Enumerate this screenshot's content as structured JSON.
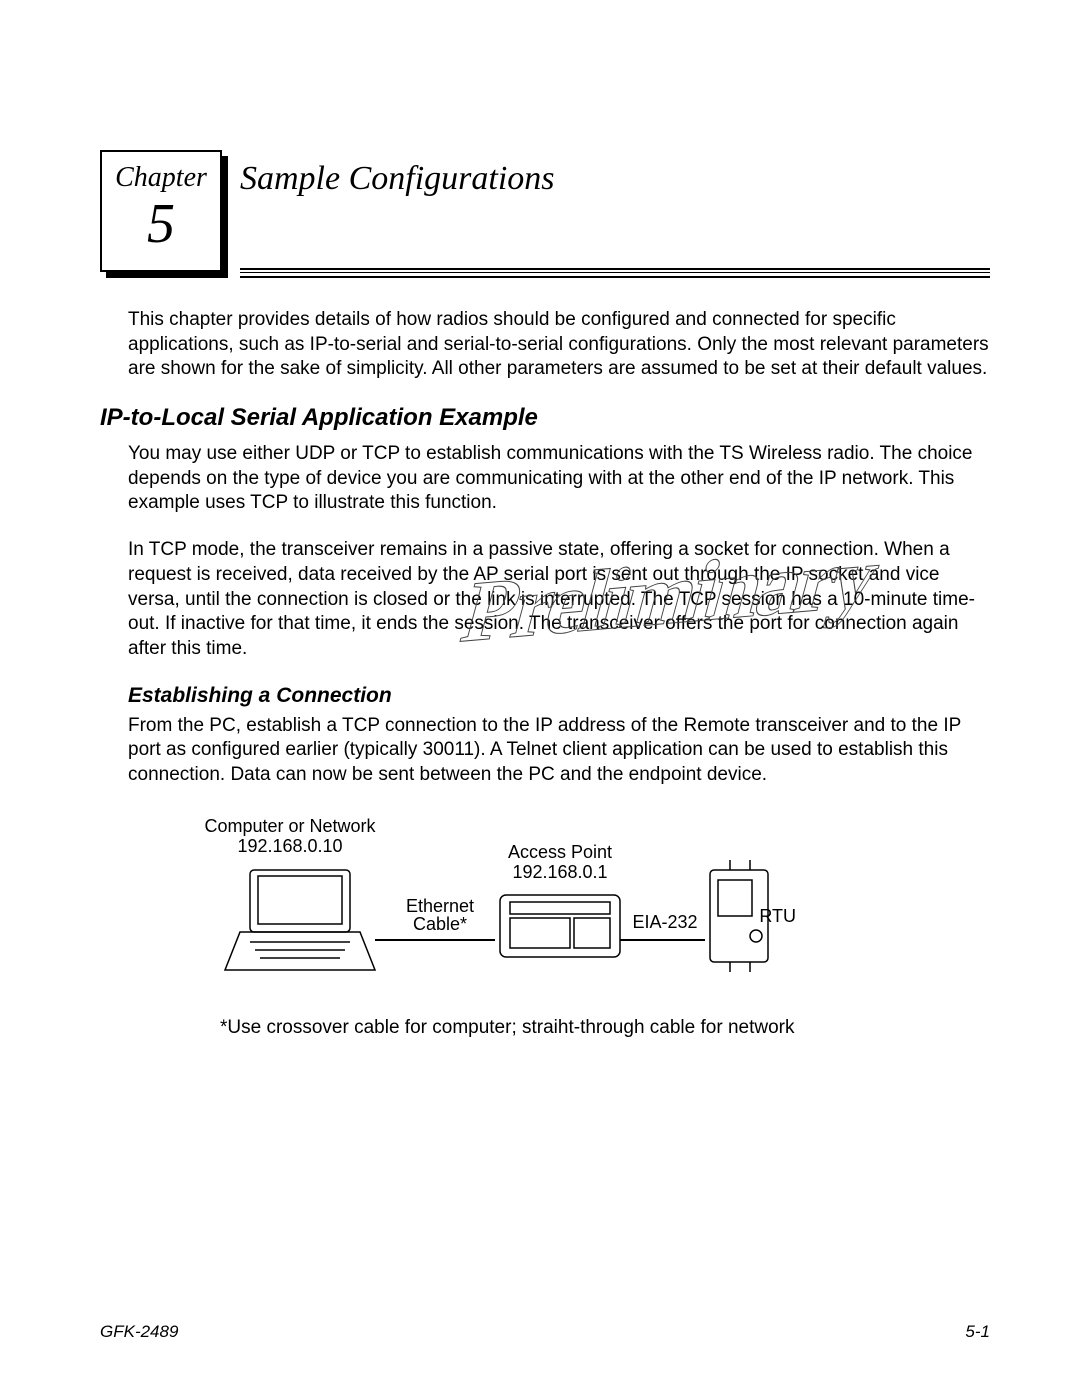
{
  "chapter": {
    "label": "Chapter",
    "number": "5",
    "title": "Sample Configurations"
  },
  "intro_paragraph": "This chapter provides details of how radios should be configured and connected for specific applications, such as IP-to-serial and serial-to-serial configurations. Only the most relevant parameters are shown for the sake of simplicity. All other parameters are assumed to be set at their default values.",
  "section1": {
    "heading": "IP-to-Local Serial Application Example",
    "p1": "You may use either UDP or TCP to establish communications with the TS Wireless radio. The choice depends on the type of device you are communicating with at the other end of the IP network. This example uses TCP to illustrate this function.",
    "p2": "In TCP mode, the transceiver remains in a passive state, offering a socket for connection. When a request is received, data received by the AP serial port is sent out through the IP socket and vice versa, until the connection is closed or the link is interrupted. The TCP session has a 10-minute time-out. If inactive for that time, it ends the session. The transceiver offers the port for connection again after this time."
  },
  "subsection1": {
    "heading": "Establishing a Connection",
    "p1": "From the PC, establish a TCP connection to the IP address of the Remote transceiver and to the IP port as configured earlier (typically 30011). A Telnet client application can be used to establish this connection. Data can now be sent between the PC and the endpoint device."
  },
  "diagram": {
    "computer_label": "Computer or Network",
    "computer_ip": "192.168.0.10",
    "ethernet_label": "Ethernet\nCable*",
    "ap_label": "Access Point",
    "ap_ip": "192.168.0.1",
    "eia_label": "EIA-232",
    "rtu_label": "RTU",
    "caption": "*Use crossover cable for computer; straiht-through cable for network"
  },
  "watermark": "Preliminary",
  "footer": {
    "left": "GFK-2489",
    "right": "5-1"
  }
}
